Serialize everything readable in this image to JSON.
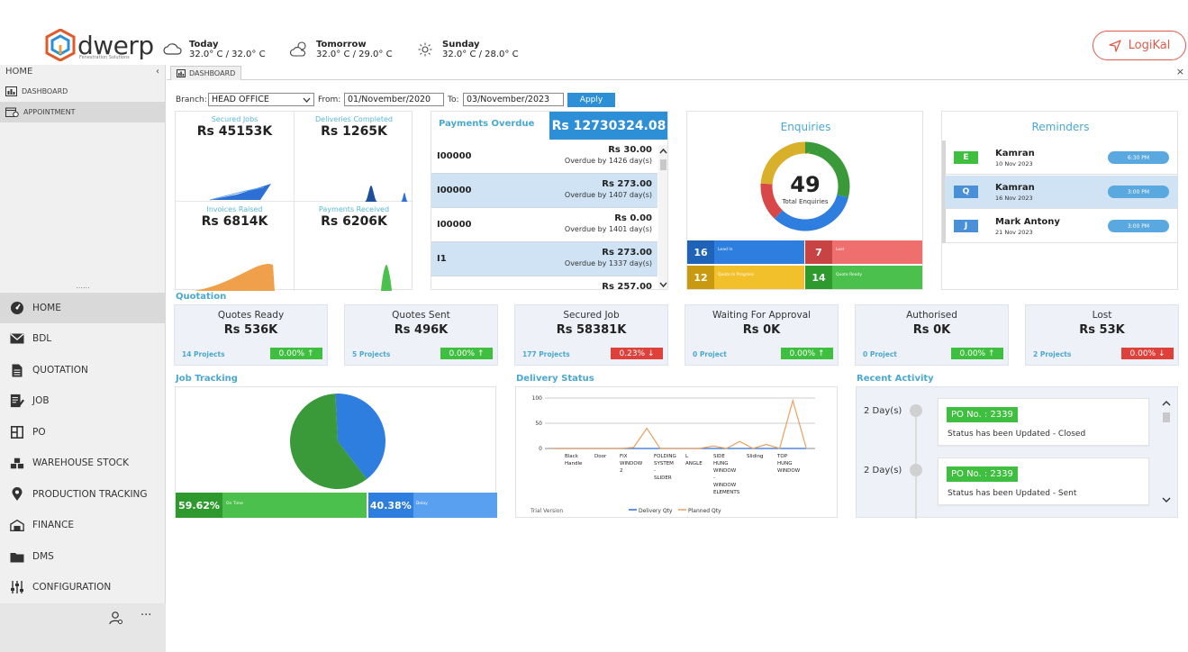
{
  "app": {
    "logo_text": "dwerp",
    "logo_sub": "Fenestration Solutions",
    "logikal_label": "LogiKal",
    "colors": {
      "accent": "#2d8fd5",
      "green": "#3fbf3f",
      "red": "#e0403a",
      "teal_title": "#4aa8d0"
    }
  },
  "weather": [
    {
      "label": "Today",
      "value": "32.0° C / 32.0° C",
      "icon": "cloud-icon"
    },
    {
      "label": "Tomorrow",
      "value": "32.0° C / 29.0° C",
      "icon": "partly-cloudy-icon"
    },
    {
      "label": "Sunday",
      "value": "32.0° C / 28.0° C",
      "icon": "sun-icon"
    }
  ],
  "sidebar": {
    "header": "HOME",
    "collapse_glyph": "‹",
    "sub_items": [
      {
        "label": "DASHBOARD",
        "icon": "dashboard-icon"
      },
      {
        "label": "APPOINTMENT",
        "icon": "appointment-icon"
      }
    ],
    "splitter": "......",
    "menu": [
      {
        "label": "HOME",
        "icon": "home-icon"
      },
      {
        "label": "BDL",
        "icon": "mail-icon"
      },
      {
        "label": "QUOTATION",
        "icon": "document-icon"
      },
      {
        "label": "JOB",
        "icon": "job-icon"
      },
      {
        "label": "PO",
        "icon": "po-icon"
      },
      {
        "label": "WAREHOUSE STOCK",
        "icon": "warehouse-icon"
      },
      {
        "label": "PRODUCTION TRACKING",
        "icon": "location-pin-icon"
      },
      {
        "label": "FINANCE",
        "icon": "finance-icon"
      },
      {
        "label": "DMS",
        "icon": "folder-icon"
      },
      {
        "label": "CONFIGURATION",
        "icon": "sliders-icon"
      }
    ],
    "more_glyph": "···"
  },
  "tabs": [
    {
      "label": "DASHBOARD"
    }
  ],
  "close_glyph": "×",
  "filter": {
    "branch_label": "Branch:",
    "branch_value": "HEAD OFFICE",
    "from_label": "From:",
    "from_value": "01/November/2020",
    "to_label": "To:",
    "to_value": "03/November/2023",
    "apply_label": "Apply"
  },
  "kpis": [
    {
      "label": "Secured Jobs",
      "value": "Rs 45153K"
    },
    {
      "label": "Deliveries Completed",
      "value": "Rs 1265K"
    },
    {
      "label": "Invoices Raised",
      "value": "Rs 6814K"
    },
    {
      "label": "Payments Received",
      "value": "Rs 6206K"
    }
  ],
  "payments_overdue": {
    "title": "Payments Overdue",
    "total": "Rs 12730324.08",
    "rows": [
      {
        "code": "I00000",
        "amount": "Rs 30.00",
        "overdue": "Overdue by 1426 day(s)"
      },
      {
        "code": "I00000",
        "amount": "Rs 273.00",
        "overdue": "Overdue by 1407 day(s)"
      },
      {
        "code": "I00000",
        "amount": "Rs 0.00",
        "overdue": "Overdue by 1401 day(s)"
      },
      {
        "code": "I1",
        "amount": "Rs 273.00",
        "overdue": "Overdue by 1337 day(s)"
      },
      {
        "code": "",
        "amount": "Rs 257.00",
        "overdue": ""
      }
    ]
  },
  "enquiries": {
    "title": "Enquiries",
    "total": "49",
    "total_label": "Total Enquiries",
    "tiles": [
      {
        "count": "16",
        "label": "Lead In",
        "color": "#2e7ee0",
        "dark": "#1f63b8"
      },
      {
        "count": "7",
        "label": "Lost",
        "color": "#ef6f6f",
        "dark": "#c84444"
      },
      {
        "count": "12",
        "label": "Quote In Progress",
        "color": "#f2c02b",
        "dark": "#c99a10"
      },
      {
        "count": "14",
        "label": "Quote Ready",
        "color": "#4cc04c",
        "dark": "#2e9a2e"
      }
    ],
    "donut_segments": [
      {
        "fraction": 0.29,
        "color": "#3a9a3a"
      },
      {
        "fraction": 0.33,
        "color": "#2e7ee0"
      },
      {
        "fraction": 0.14,
        "color": "#d94848"
      },
      {
        "fraction": 0.24,
        "color": "#d9b02a"
      }
    ]
  },
  "reminders": {
    "title": "Reminders",
    "items": [
      {
        "letter": "E",
        "name": "Kamran",
        "date": "10 Nov 2023",
        "time": "6:30 PM",
        "color": "#3fbf3f"
      },
      {
        "letter": "Q",
        "name": "Kamran",
        "date": "16 Nov 2023",
        "time": "3:00 PM",
        "color": "#4a90d9"
      },
      {
        "letter": "J",
        "name": "Mark Antony",
        "date": "21 Nov 2023",
        "time": "3:00 PM",
        "color": "#4a90d9"
      }
    ]
  },
  "quotation": {
    "title": "Quotation",
    "cards": [
      {
        "title": "Quotes Ready",
        "value": "Rs 536K",
        "projects": "14 Projects",
        "pct": "0.00% ↑",
        "trend": "up"
      },
      {
        "title": "Quotes Sent",
        "value": "Rs 496K",
        "projects": "5 Projects",
        "pct": "0.00% ↑",
        "trend": "up"
      },
      {
        "title": "Secured Job",
        "value": "Rs 58381K",
        "projects": "177 Projects",
        "pct": "0.23% ↓",
        "trend": "down"
      },
      {
        "title": "Waiting For Approval",
        "value": "Rs 0K",
        "projects": "0 Project",
        "pct": "0.00% ↑",
        "trend": "up"
      },
      {
        "title": "Authorised",
        "value": "Rs 0K",
        "projects": "0 Project",
        "pct": "0.00% ↑",
        "trend": "up"
      },
      {
        "title": "Lost",
        "value": "Rs 53K",
        "projects": "2 Projects",
        "pct": "0.00% ↓",
        "trend": "down"
      }
    ]
  },
  "job_tracking": {
    "title": "Job Tracking",
    "ontime_pct": "59.62%",
    "ontime_label": "On Time",
    "delay_pct": "40.38%",
    "delay_label": "Delay",
    "ontime_fraction": 0.5962,
    "delay_fraction": 0.4038
  },
  "delivery_status": {
    "title": "Delivery Status",
    "trial_label": "Trial Version"
  },
  "chart_data": {
    "type": "line",
    "categories": [
      "Black Handle",
      "Door",
      "FIX WINDOW 2",
      "FOLDING SYSTEM - SLIDER",
      "L ANGLE",
      "SIDE HUNG WINDOW - WINDOW ELEMENTS",
      "Sliding",
      "TOP HUNG WINDOW"
    ],
    "ylim": [
      0,
      100
    ],
    "yticks": [
      "100",
      "50",
      "0"
    ],
    "series": [
      {
        "name": "Delivery Qty",
        "color": "#2e6fd6",
        "values": [
          0,
          0,
          0,
          0,
          0,
          0,
          0,
          0,
          0,
          0,
          0,
          0,
          0,
          0,
          0,
          0,
          0,
          0,
          0,
          0
        ]
      },
      {
        "name": "Planned Qty",
        "color": "#e9a060",
        "values": [
          0,
          0,
          0,
          0,
          0,
          0,
          2,
          40,
          0,
          0,
          0,
          0,
          5,
          0,
          14,
          0,
          8,
          0,
          95,
          2
        ]
      }
    ]
  },
  "recent_activity": {
    "title": "Recent Activity",
    "items": [
      {
        "days": "2 Day(s)",
        "po": "PO No. : 2339",
        "status": "Status has been Updated - Closed"
      },
      {
        "days": "2 Day(s)",
        "po": "PO No. : 2339",
        "status": "Status has been Updated - Sent"
      }
    ]
  }
}
